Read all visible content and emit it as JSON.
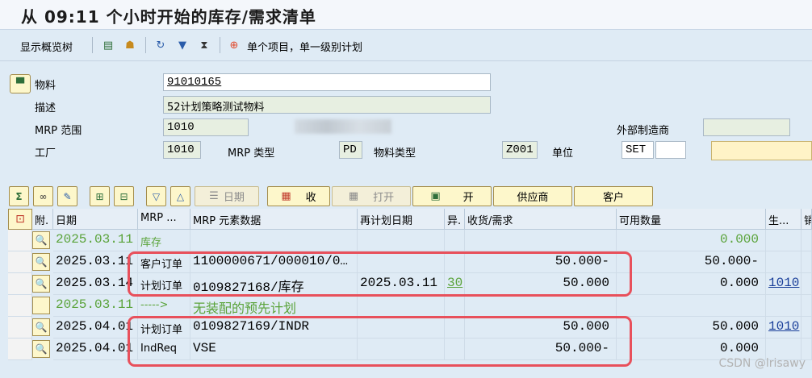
{
  "window": {
    "title": "从 09:11 个小时开始的库存/需求清单"
  },
  "toolbar": {
    "overview_label": "显示概览树",
    "single_item_label": "单个项目，单一级别计划"
  },
  "header": {
    "material_label": "物料",
    "material_value": "91010165",
    "description_label": "描述",
    "description_value": "52计划策略测试物料",
    "mrp_area_label": "MRP 范围",
    "mrp_area_value": "1010",
    "external_label": "外部制造商",
    "external_value": "",
    "plant_label": "工厂",
    "plant_value": "1010",
    "mrp_type_label": "MRP 类型",
    "mrp_type_value": "PD",
    "material_type_label": "物料类型",
    "material_type_value": "Z001",
    "unit_label": "单位",
    "unit_value": "SET",
    "unit_extra": ""
  },
  "actions": {
    "date_btn": "日期",
    "receipt_btn": "收",
    "open_btn": "打开",
    "open2_btn": "开",
    "vendor_btn": "供应商",
    "customer_btn": "客户"
  },
  "grid": {
    "columns": [
      "附.",
      "日期",
      "MRP ...",
      "MRP 元素数据",
      "再计划日期",
      "异.",
      "收货/需求",
      "可用数量",
      "生...",
      "销"
    ],
    "rows": [
      {
        "date": "2025.03.11",
        "mrp": "库存",
        "data": "",
        "resched": "",
        "exc": "",
        "qty": "",
        "avail": "0.000",
        "prod": "",
        "style": "green"
      },
      {
        "date": "2025.03.11",
        "mrp": "客户订单",
        "data": "1100000671/000010/0…",
        "resched": "",
        "exc": "",
        "qty": "50.000-",
        "avail": "50.000-",
        "prod": "",
        "style": "normal"
      },
      {
        "date": "2025.03.14",
        "mrp": "计划订单",
        "data": "0109827168/库存",
        "resched": "2025.03.11",
        "exc": "30",
        "qty": "50.000",
        "avail": "0.000",
        "prod": "1010",
        "style": "normal"
      },
      {
        "date": "2025.03.11",
        "mrp": "----->",
        "data": "无装配的预先计划",
        "resched": "",
        "exc": "",
        "qty": "",
        "avail": "",
        "prod": "",
        "style": "green"
      },
      {
        "date": "2025.04.01",
        "mrp": "计划订单",
        "data": "0109827169/INDR",
        "resched": "",
        "exc": "",
        "qty": "50.000",
        "avail": "50.000",
        "prod": "1010",
        "style": "normal"
      },
      {
        "date": "2025.04.01",
        "mrp": "IndReq",
        "data": "VSE",
        "resched": "",
        "exc": "",
        "qty": "50.000-",
        "avail": "0.000",
        "prod": "",
        "style": "normal"
      }
    ]
  },
  "watermark": "CSDN @lrisawy",
  "colors": {
    "highlight_border": "#e8505b",
    "green_text": "#5aa33a",
    "button_yellow": "#fdf7cb"
  }
}
